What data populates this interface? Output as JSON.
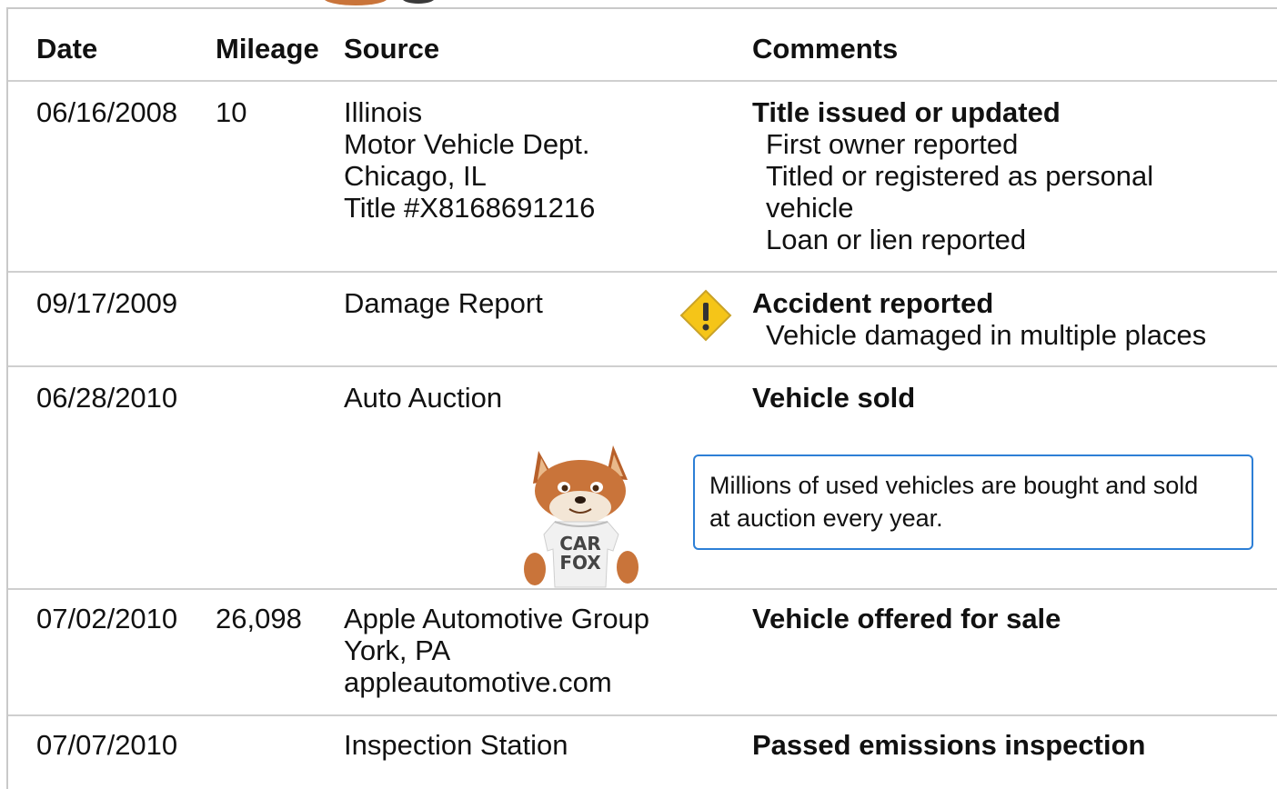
{
  "table": {
    "headers": {
      "date": "Date",
      "mileage": "Mileage",
      "source": "Source",
      "comments": "Comments"
    },
    "rows": [
      {
        "date": "06/16/2008",
        "mileage": "10",
        "source": [
          "Illinois",
          "Motor Vehicle Dept.",
          "Chicago, IL",
          "Title #X8168691216"
        ],
        "comment_title": "Title issued or updated",
        "comment_items": [
          "First owner reported",
          "Titled or registered as personal",
          "vehicle",
          "Loan or lien reported"
        ]
      },
      {
        "date": "09/17/2009",
        "mileage": "",
        "source": [
          "Damage Report"
        ],
        "icon": "warning-diamond-icon",
        "comment_title": "Accident reported",
        "comment_items": [
          "Vehicle damaged in multiple places"
        ]
      },
      {
        "date": "06/28/2010",
        "mileage": "",
        "source": [
          "Auto Auction"
        ],
        "comment_title": "Vehicle sold",
        "comment_items": [],
        "callout": [
          "Millions of used vehicles are bought and sold",
          "at auction every year."
        ],
        "mascot": {
          "icon": "carfox-mascot-icon",
          "shirt_text": [
            "CAR",
            "FOX"
          ]
        }
      },
      {
        "date": "07/02/2010",
        "mileage": "26,098",
        "source": [
          "Apple Automotive Group",
          "York, PA",
          "appleautomotive.com"
        ],
        "comment_title": "Vehicle offered for sale",
        "comment_items": []
      },
      {
        "date": "07/07/2010",
        "mileage": "",
        "source": [
          "Inspection Station"
        ],
        "comment_title": "Passed emissions inspection",
        "comment_items": []
      }
    ]
  },
  "colors": {
    "warning": "#f5c518",
    "callout_border": "#2d7fd6",
    "divider": "#cfcfcf"
  }
}
